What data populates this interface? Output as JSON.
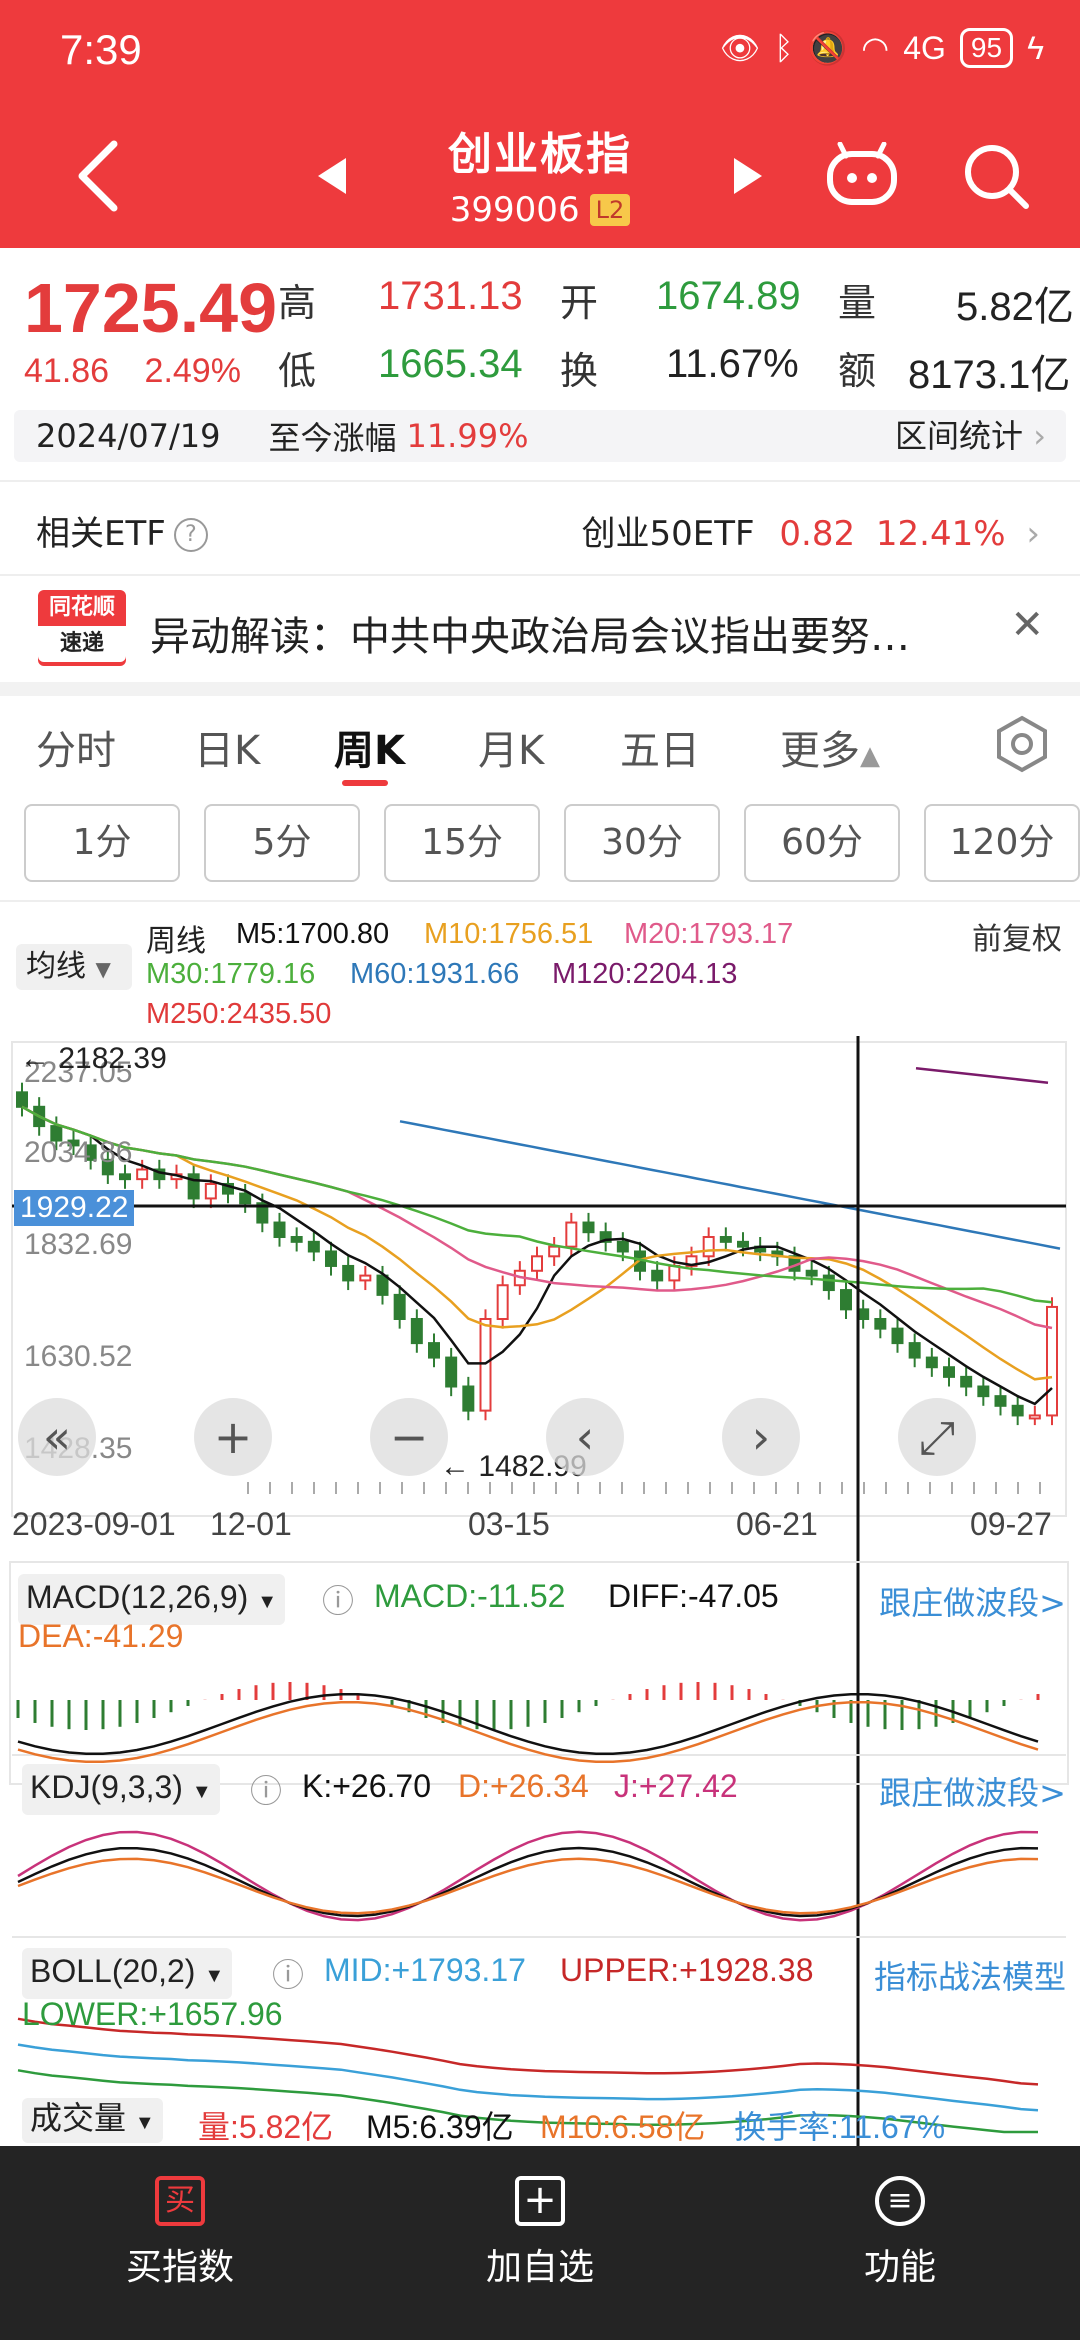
{
  "status": {
    "time": "7:39",
    "battery": "95",
    "signal": "4G"
  },
  "header": {
    "title": "创业板指",
    "code": "399006",
    "badge": "L2"
  },
  "quote": {
    "price": "1725.49",
    "change": "41.86",
    "change_pct": "2.49%",
    "high_label": "高",
    "high": "1731.13",
    "low_label": "低",
    "low": "1665.34",
    "open_label": "开",
    "open": "1674.89",
    "turnover_label": "换",
    "turnover": "11.67%",
    "volume_label": "量",
    "volume": "5.82亿",
    "amount_label": "额",
    "amount": "8173.1亿",
    "date": "2024/07/19",
    "since_label": "至今涨幅",
    "since_pct": "11.99%",
    "range_stat": "区间统计"
  },
  "etf": {
    "label": "相关ETF",
    "name": "创业50ETF",
    "price": "0.82",
    "pct": "12.41%"
  },
  "news": {
    "logo_top": "同花顺",
    "logo_bottom": "速递",
    "text": "异动解读：中共中央政治局会议指出要努…"
  },
  "tabs": [
    "分时",
    "日K",
    "周K",
    "月K",
    "五日",
    "更多"
  ],
  "periods": [
    "1分",
    "5分",
    "15分",
    "30分",
    "60分",
    "120分"
  ],
  "ma": {
    "avg_btn": "均线",
    "type": "周线",
    "fuquan": "前复权",
    "m5": "M5:1700.80",
    "m10": "M10:1756.51",
    "m20": "M20:1793.17",
    "m30": "M30:1779.16",
    "m60": "M60:1931.66",
    "m120": "M120:2204.13",
    "m250": "M250:2435.50"
  },
  "colors": {
    "m5": "#111111",
    "m10": "#e8a020",
    "m20": "#e05a8a",
    "m30": "#4caf3c",
    "m60": "#2e78b8",
    "m120": "#7a1a6a",
    "m250": "#e03a3a",
    "up": "#e33c3c",
    "down": "#2e7d32"
  },
  "chart_data": {
    "type": "candlestick",
    "y_axis_labels": [
      "2237.05",
      "2034.86",
      "1832.69",
      "1630.52",
      "1428.35"
    ],
    "y_axis_values": [
      2237.05,
      2034.86,
      1832.69,
      1630.52,
      1428.35
    ],
    "crosshair_value": "1929.22",
    "high_marker": "2182.39",
    "low_marker": "1482.99",
    "x_labels": [
      "2023-09-01",
      "12-01",
      "03-15",
      "06-21",
      "09-27"
    ],
    "closes": [
      2140,
      2100,
      2070,
      2060,
      2030,
      2000,
      1990,
      2010,
      1990,
      2000,
      1950,
      1980,
      1960,
      1940,
      1900,
      1870,
      1860,
      1840,
      1810,
      1780,
      1790,
      1750,
      1700,
      1650,
      1620,
      1560,
      1510,
      1700,
      1770,
      1800,
      1830,
      1850,
      1900,
      1880,
      1860,
      1840,
      1800,
      1780,
      1810,
      1830,
      1870,
      1860,
      1850,
      1840,
      1830,
      1800,
      1790,
      1760,
      1720,
      1700,
      1680,
      1650,
      1620,
      1600,
      1580,
      1560,
      1540,
      1520,
      1500,
      1500,
      1725
    ]
  },
  "macd": {
    "name": "MACD(12,26,9)",
    "macd": "MACD:-11.52",
    "diff": "DIFF:-47.05",
    "dea": "DEA:-41.29",
    "link": "跟庄做波段>"
  },
  "kdj": {
    "name": "KDJ(9,3,3)",
    "k": "K:+26.70",
    "d": "D:+26.34",
    "j": "J:+27.42",
    "link": "跟庄做波段>"
  },
  "boll": {
    "name": "BOLL(20,2)",
    "mid": "MID:+1793.17",
    "upper": "UPPER:+1928.38",
    "lower": "LOWER:+1657.96",
    "link": "指标战法模型"
  },
  "vol": {
    "name": "成交量",
    "vol": "量:5.82亿",
    "m5": "M5:6.39亿",
    "m10": "M10:6.58亿",
    "turnover": "换手率:11.67%"
  },
  "bottom": {
    "buy": "买指数",
    "buy_icon": "买",
    "add": "加自选",
    "func": "功能"
  }
}
